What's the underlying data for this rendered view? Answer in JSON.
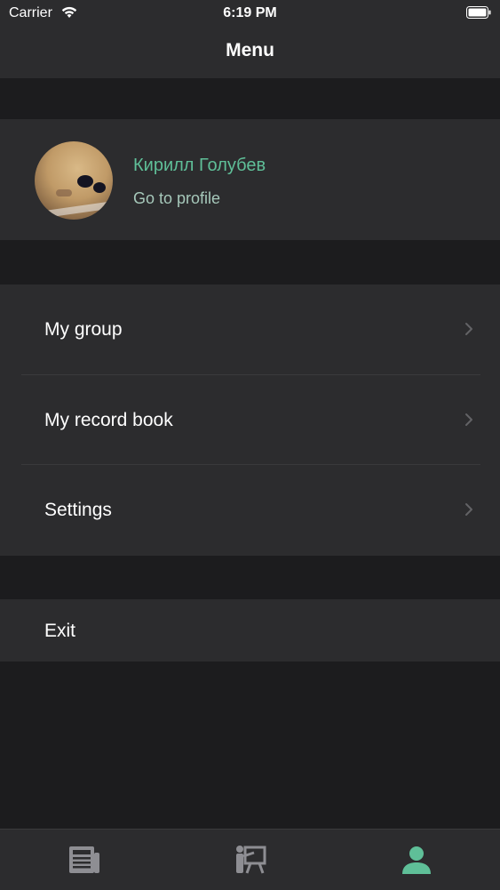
{
  "status_bar": {
    "carrier": "Carrier",
    "time": "6:19 PM"
  },
  "nav": {
    "title": "Menu"
  },
  "profile": {
    "name": "Кирилл Голубев",
    "subtitle": "Go to profile"
  },
  "menu": {
    "items": [
      {
        "label": "My group"
      },
      {
        "label": "My record book"
      },
      {
        "label": "Settings"
      }
    ]
  },
  "exit": {
    "label": "Exit"
  },
  "tab_bar": {
    "tabs": [
      {
        "icon": "news-icon"
      },
      {
        "icon": "teacher-icon"
      },
      {
        "icon": "person-icon",
        "active": true
      }
    ],
    "active_color": "#5fbf98",
    "inactive_color": "#8e8e93"
  },
  "colors": {
    "accent": "#5fbf98",
    "background": "#1c1c1e",
    "cell": "#2c2c2e"
  }
}
